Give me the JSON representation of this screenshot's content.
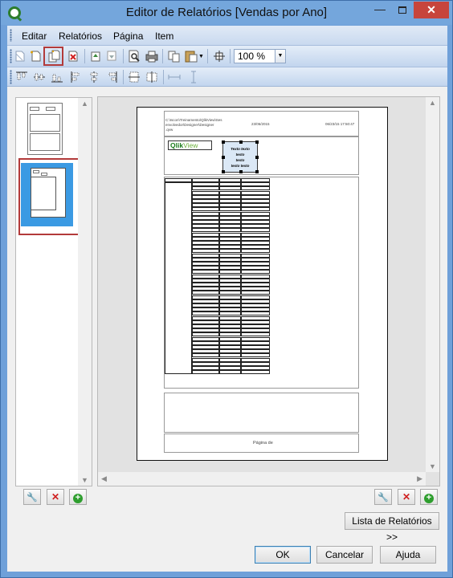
{
  "window": {
    "title": "Editor de Relatórios [Vendas por Ano]",
    "minimize": "—",
    "close": "✕"
  },
  "menu": [
    {
      "label": "Editar"
    },
    {
      "label": "Relatórios"
    },
    {
      "label": "Página"
    },
    {
      "label": "Item"
    }
  ],
  "toolbar": {
    "zoom": "100 %"
  },
  "paper": {
    "path": "C:\\Iscon\\Treinamento\\QlikView\\Designer\\Designer.qvw",
    "path_line1": "C:\\Iscon\\Treinamento\\QlikView\\Ses",
    "path_line2": "envolvedor\\Designer\\Designer",
    "path_line3": ".qvw",
    "date": "23/06/2015",
    "datetime": "06/23/15 17:50:47",
    "logo_brand": "Qlik",
    "logo_view": "View",
    "text_object_lines": [
      "Texto texto",
      "texto",
      "texto",
      "texto texto"
    ],
    "footer": "Página de"
  },
  "buttons": {
    "report_list": "Lista de Relatórios >>",
    "ok": "OK",
    "cancel": "Cancelar",
    "help": "Ajuda",
    "wrench": "🔧",
    "delete": "✕",
    "add": "+"
  },
  "colors": {
    "accent": "#3b9ae3",
    "highlight": "#b23a3a",
    "titlebar": "#74a6dc",
    "close": "#c7453c"
  }
}
